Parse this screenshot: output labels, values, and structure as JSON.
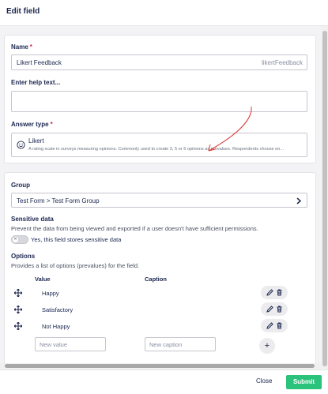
{
  "header": {
    "title": "Edit field"
  },
  "field": {
    "name_label": "Name",
    "required_marker": "*",
    "name_value": "Likert Feedback",
    "alias": "likertFeedback",
    "help_label": "Enter help text...",
    "help_value": "",
    "answer_type_label": "Answer type",
    "answer_type": {
      "icon": "smile-icon",
      "name": "Likert",
      "description": "A rating scale in surveys measuring opinions. Commonly used to create 3, 5 or 6 opinions as prevalues. Respondents choose on..."
    }
  },
  "settings": {
    "group_label": "Group",
    "group_value": "Test Form > Test Form Group",
    "sensitive_label": "Sensitive data",
    "sensitive_desc": "Prevent the data from being viewed and exported if a user doesn't have sufficient permissions.",
    "toggle_knob": "✕",
    "sensitive_toggle_label": "Yes, this field stores sensitive data",
    "sensitive_on": false,
    "options_label": "Options",
    "options_desc": "Provides a list of options (prevalues) for the field.",
    "col_value": "Value",
    "col_caption": "Caption",
    "options": [
      {
        "value": "Happy",
        "caption": ""
      },
      {
        "value": "Satisfactory",
        "caption": ""
      },
      {
        "value": "Not Happy",
        "caption": ""
      }
    ],
    "new_value_placeholder": "New value",
    "new_caption_placeholder": "New caption",
    "add_symbol": "+"
  },
  "footer": {
    "close_label": "Close",
    "submit_label": "Submit"
  },
  "colors": {
    "primary_text": "#1b264f",
    "required": "#d42054",
    "submit_bg": "#2bc37c",
    "annotation": "#e03a3a"
  }
}
